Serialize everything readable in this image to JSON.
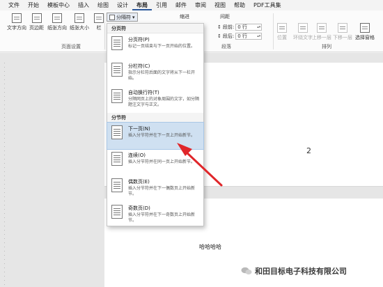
{
  "menu": {
    "tabs": [
      "文件",
      "开始",
      "模板中心",
      "插入",
      "绘图",
      "设计",
      "布局",
      "引用",
      "邮件",
      "审阅",
      "视图",
      "帮助",
      "PDF工具集"
    ],
    "active": "布局"
  },
  "ribbon": {
    "page_setup": {
      "buttons": [
        "文字方向",
        "页边距",
        "纸张方向",
        "纸张大小",
        "栏"
      ],
      "label": "页面设置"
    },
    "breaks_button": "分隔符",
    "indent_header": "缩进",
    "spacing_header": "间距",
    "spacing_before_label": "段前:",
    "spacing_before_value": "0 行",
    "spacing_after_label": "段后:",
    "spacing_after_value": "0 行",
    "paragraph_label": "段落",
    "arrange": {
      "buttons": [
        "位置",
        "环绕文字",
        "上移一层",
        "下移一层",
        "选择窗格"
      ],
      "label": "排列"
    }
  },
  "dropdown": {
    "page_breaks_header": "分页符",
    "section_breaks_header": "分节符",
    "page_breaks": [
      {
        "title": "分页符(P)",
        "desc": "标记一页结束与下一页开始的位置。"
      },
      {
        "title": "分栏符(C)",
        "desc": "指示分栏符后面的文字将从下一栏开始。"
      },
      {
        "title": "自动换行符(T)",
        "desc": "分隔网页上的对象周围的文字，如分隔题注文字与正文。"
      }
    ],
    "section_breaks": [
      {
        "title": "下一页(N)",
        "desc": "插入分节符并在下一页上开始新节。"
      },
      {
        "title": "连续(O)",
        "desc": "插入分节符并在同一页上开始新节。"
      },
      {
        "title": "偶数页(E)",
        "desc": "插入分节符并在下一偶数页上开始新节。"
      },
      {
        "title": "奇数页(D)",
        "desc": "插入分节符并在下一奇数页上开始新节。"
      }
    ]
  },
  "document": {
    "page_number": "2",
    "body_text": "哈哈哈哈"
  },
  "watermark": "和田目标电子科技有限公司",
  "colors": {
    "accent": "#2b579a",
    "highlight": "#cfe0f1",
    "arrow": "#e0262a"
  }
}
